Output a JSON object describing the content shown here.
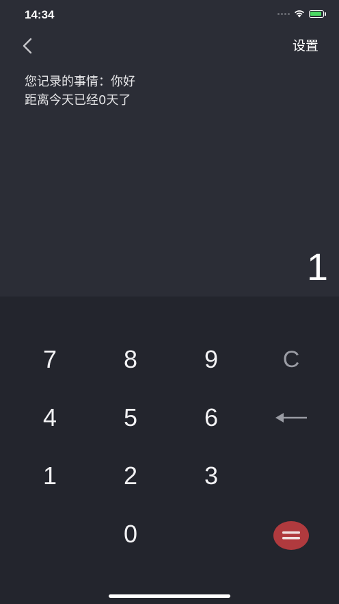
{
  "status_bar": {
    "time": "14:34"
  },
  "nav": {
    "back_icon": "chevron-left-icon",
    "settings_label": "设置"
  },
  "record": {
    "line1": "您记录的事情：你好",
    "line2": "距离今天已经0天了"
  },
  "display": {
    "value": "1"
  },
  "keypad": {
    "keys": {
      "k7": "7",
      "k8": "8",
      "k9": "9",
      "clear": "C",
      "k4": "4",
      "k5": "5",
      "k6": "6",
      "k1": "1",
      "k2": "2",
      "k3": "3",
      "k0": "0"
    },
    "backspace_icon": "left-arrow-icon",
    "equals_icon": "equals-icon"
  },
  "colors": {
    "background": "#2b2d36",
    "keypad_background": "#23252d",
    "equals_button": "#b03a3e",
    "battery_fill": "#4cd964"
  }
}
